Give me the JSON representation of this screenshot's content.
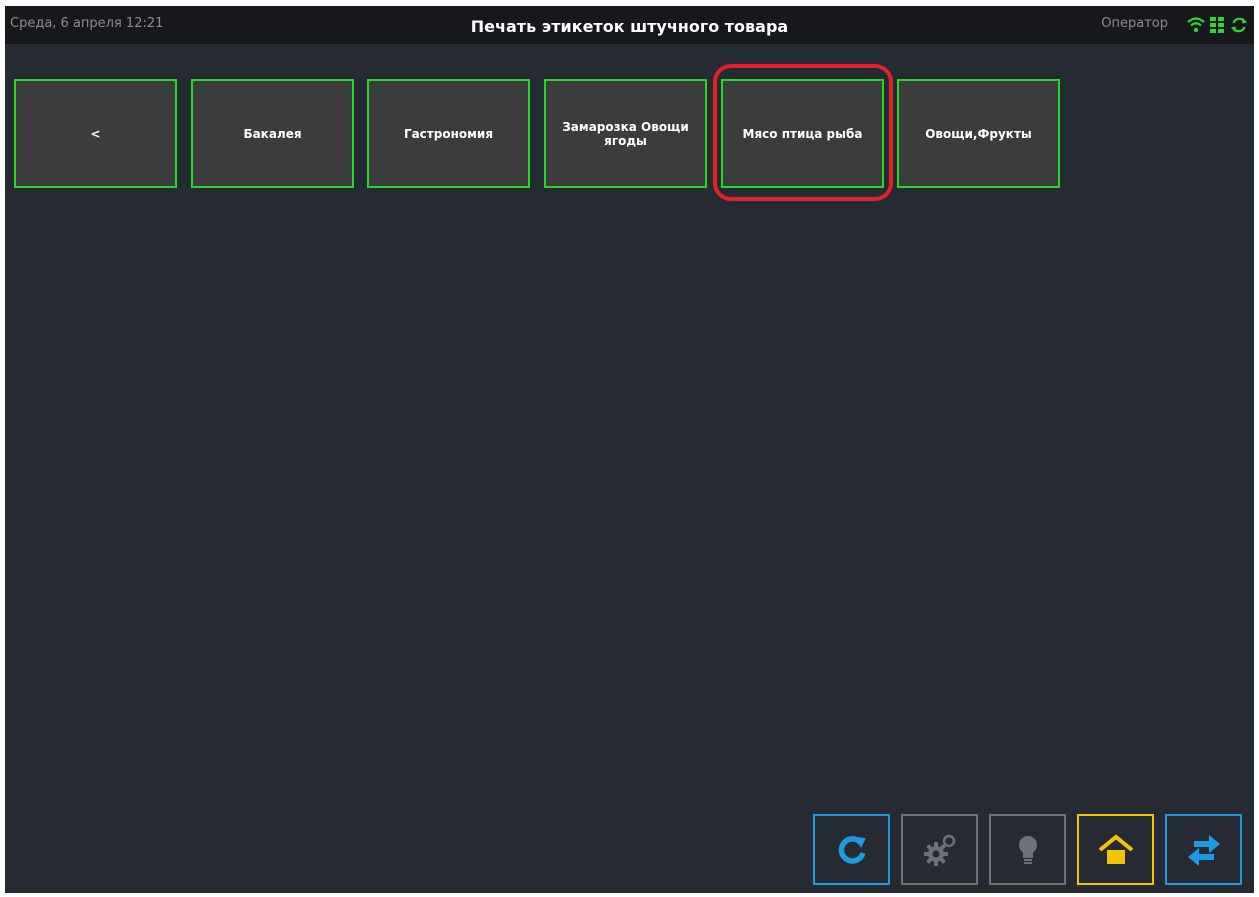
{
  "header": {
    "date": "Среда, 6 апреля 12:21",
    "title": "Печать этикеток штучного товара",
    "operator": "Оператор"
  },
  "categories": [
    {
      "label": "<"
    },
    {
      "label": "Бакалея"
    },
    {
      "label": "Гастрономия"
    },
    {
      "label": "Замарозка Овощи ягоды"
    },
    {
      "label": "Мясо птица рыба"
    },
    {
      "label": "Овощи,Фрукты"
    }
  ],
  "colors": {
    "background": "#262a33",
    "topbar": "#16181c",
    "button_fill": "#3c3c3c",
    "button_border": "#21dc21",
    "highlight": "#e2202a",
    "tool_blue": "#1e9be0",
    "tool_gray": "#6e7278",
    "tool_yellow": "#f5c400"
  },
  "status_icons": [
    "wifi-icon",
    "network-icon",
    "sync-icon"
  ],
  "toolbar": [
    {
      "icon": "refresh-icon"
    },
    {
      "icon": "settings-icon"
    },
    {
      "icon": "lightbulb-icon"
    },
    {
      "icon": "home-icon"
    },
    {
      "icon": "swap-icon"
    }
  ]
}
